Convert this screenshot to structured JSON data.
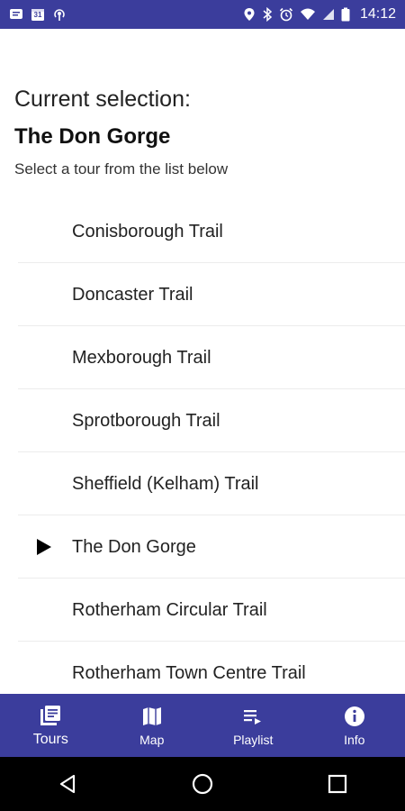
{
  "status_bar": {
    "time": "14:12",
    "left_icons": [
      "message-icon",
      "calendar-icon",
      "podcast-icon"
    ],
    "calendar_day": "31",
    "right_icons": [
      "location-icon",
      "bluetooth-icon",
      "alarm-icon",
      "wifi-icon",
      "signal-icon",
      "battery-icon"
    ]
  },
  "header": {
    "title": "Current selection:",
    "current": "The Don Gorge",
    "hint": "Select a tour from the list below"
  },
  "tours": [
    {
      "label": "Conisborough Trail",
      "selected": false
    },
    {
      "label": "Doncaster Trail",
      "selected": false
    },
    {
      "label": "Mexborough Trail",
      "selected": false
    },
    {
      "label": "Sprotborough Trail",
      "selected": false
    },
    {
      "label": "Sheffield (Kelham) Trail",
      "selected": false
    },
    {
      "label": "The Don Gorge",
      "selected": true
    },
    {
      "label": "Rotherham Circular Trail",
      "selected": false
    },
    {
      "label": "Rotherham Town Centre Trail",
      "selected": false
    }
  ],
  "bottom_nav": {
    "items": [
      {
        "label": "Tours",
        "icon": "tours-icon",
        "active": true
      },
      {
        "label": "Map",
        "icon": "map-icon",
        "active": false
      },
      {
        "label": "Playlist",
        "icon": "playlist-icon",
        "active": false
      },
      {
        "label": "Info",
        "icon": "info-icon",
        "active": false
      }
    ]
  },
  "colors": {
    "primary": "#3b3d9c",
    "system_nav": "#000000",
    "background": "#ffffff"
  }
}
